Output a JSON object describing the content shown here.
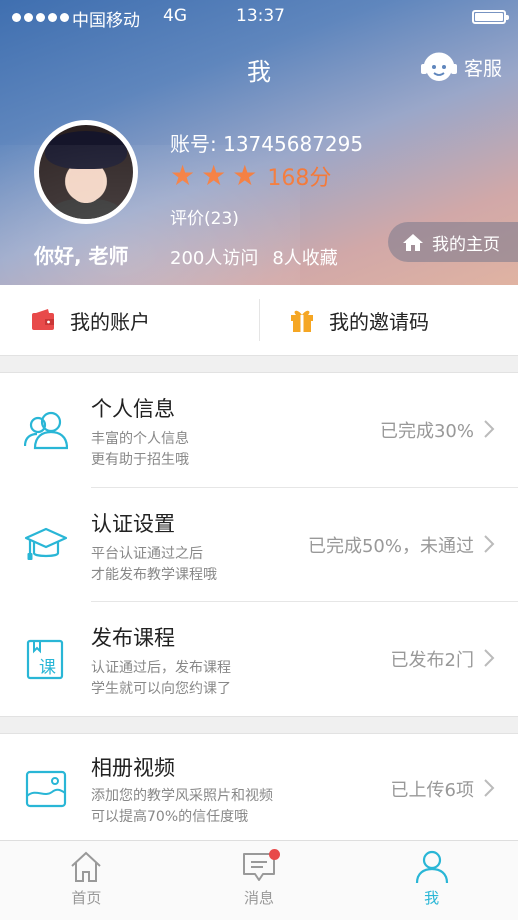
{
  "status_bar": {
    "carrier": "中国移动",
    "network": "4G",
    "time": "13:37"
  },
  "header": {
    "title": "我",
    "service_label": "客服"
  },
  "profile": {
    "greeting": "你好, 老师",
    "account": "账号: 13745687295",
    "rating_stars": 3,
    "score": "168分",
    "reviews": "评价(23)",
    "visits": "200人访问",
    "favorites": "8人收藏",
    "homepage_label": "我的主页"
  },
  "quick_links": [
    {
      "label": "我的账户",
      "icon": "wallet-icon",
      "color": "#e84a4a"
    },
    {
      "label": "我的邀请码",
      "icon": "gift-icon",
      "color": "#f5a623"
    }
  ],
  "menu": [
    {
      "title": "个人信息",
      "desc": [
        "丰富的个人信息",
        "更有助于招生哦"
      ],
      "status": "已完成30%",
      "icon": "users-icon"
    },
    {
      "title": "认证设置",
      "desc": [
        "平台认证通过之后",
        "才能发布教学课程哦"
      ],
      "status": "已完成50%，未通过",
      "icon": "graduation-cap-icon"
    },
    {
      "title": "发布课程",
      "desc": [
        "认证通过后，发布课程",
        "学生就可以向您约课了"
      ],
      "status": "已发布2门",
      "icon": "course-book-icon",
      "icon_text": "课"
    },
    {
      "title": "相册视频",
      "desc": [
        "添加您的教学风采照片和视频",
        "可以提高70%的信任度哦"
      ],
      "status": "已上传6项",
      "icon": "photo-album-icon"
    }
  ],
  "tabbar": [
    {
      "label": "首页",
      "icon": "home-icon",
      "active": false,
      "badge": false
    },
    {
      "label": "消息",
      "icon": "message-icon",
      "active": false,
      "badge": true
    },
    {
      "label": "我",
      "icon": "profile-icon",
      "active": true,
      "badge": false
    }
  ],
  "colors": {
    "accent": "#29b6d6",
    "star": "#f47a3a",
    "badge": "#e84a4a"
  }
}
